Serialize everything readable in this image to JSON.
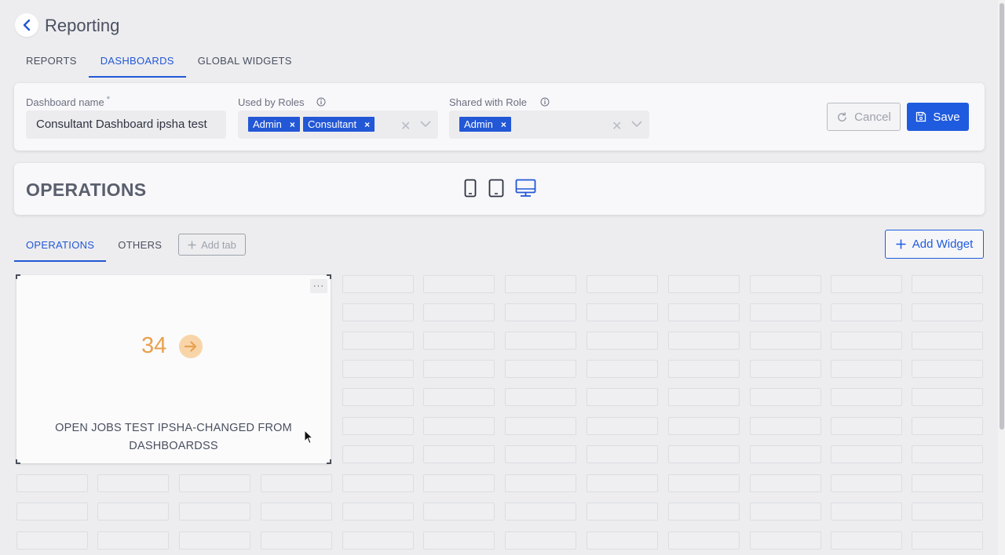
{
  "header": {
    "title": "Reporting"
  },
  "main_tabs": [
    {
      "label": "REPORTS",
      "active": false
    },
    {
      "label": "DASHBOARDS",
      "active": true
    },
    {
      "label": "GLOBAL WIDGETS",
      "active": false
    }
  ],
  "settings": {
    "dashboard_name": {
      "label": "Dashboard name",
      "required_mark": "*",
      "value": "Consultant Dashboard ipsha test"
    },
    "used_by_roles": {
      "label": "Used by Roles",
      "chips": [
        "Admin",
        "Consultant"
      ]
    },
    "shared_with_role": {
      "label": "Shared with Role",
      "chips": [
        "Admin"
      ]
    },
    "chip_remove": "×",
    "clear_symbol": "✕",
    "cancel_label": "Cancel",
    "save_label": "Save"
  },
  "section": {
    "title": "OPERATIONS",
    "devices": [
      "mobile-icon",
      "tablet-icon",
      "desktop-icon"
    ],
    "active_device": "desktop"
  },
  "sub_tabs": [
    {
      "label": "OPERATIONS",
      "active": true
    },
    {
      "label": "OTHERS",
      "active": false
    }
  ],
  "add_tab_label": "Add tab",
  "add_widget_label": "Add Widget",
  "widget": {
    "menu": "···",
    "value": "34",
    "label": "OPEN JOBS TEST IPSHA-CHANGED FROM DASHBOARDSS"
  },
  "colors": {
    "accent": "#1f5bdf",
    "widget_value": "#e8a14f",
    "widget_arrow_bg": "#f8d5a9"
  }
}
